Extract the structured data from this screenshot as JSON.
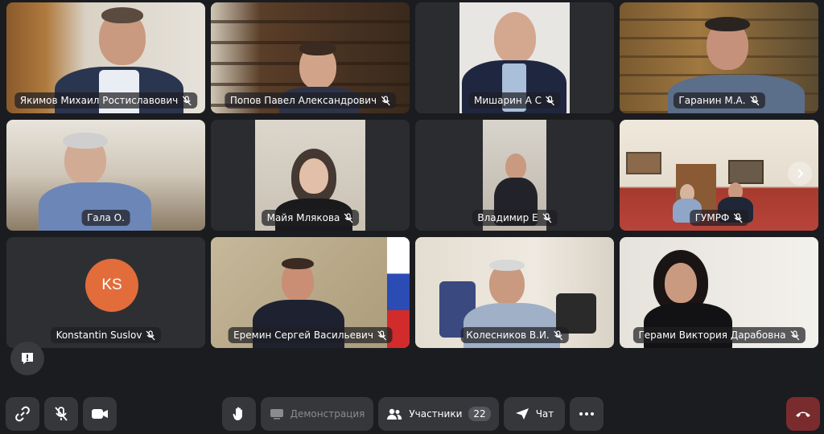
{
  "participants": [
    {
      "name": "Якимов Михаил Ростиславович"
    },
    {
      "name": "Попов Павел Александрович"
    },
    {
      "name": "Мишарин А С"
    },
    {
      "name": "Гаранин М.А."
    },
    {
      "name": "Гала О."
    },
    {
      "name": "Майя Млякова"
    },
    {
      "name": "Владимир Е"
    },
    {
      "name": "ГУМРФ"
    },
    {
      "name": "Konstantin Suslov",
      "initials": "KS"
    },
    {
      "name": "Еремин Сергей Васильевич"
    },
    {
      "name": "Колесников В.И."
    },
    {
      "name": "Герами Виктория Дарабовна"
    }
  ],
  "toolbar": {
    "demo_label": "Демонстрация",
    "participants_label": "Участники",
    "participants_count": "22",
    "chat_label": "Чат"
  },
  "colors": {
    "background": "#1b1c1f",
    "tile": "#2b2c30",
    "button": "#36373b",
    "hangup": "#7a2b2e",
    "avatar": "#e26d3a"
  }
}
